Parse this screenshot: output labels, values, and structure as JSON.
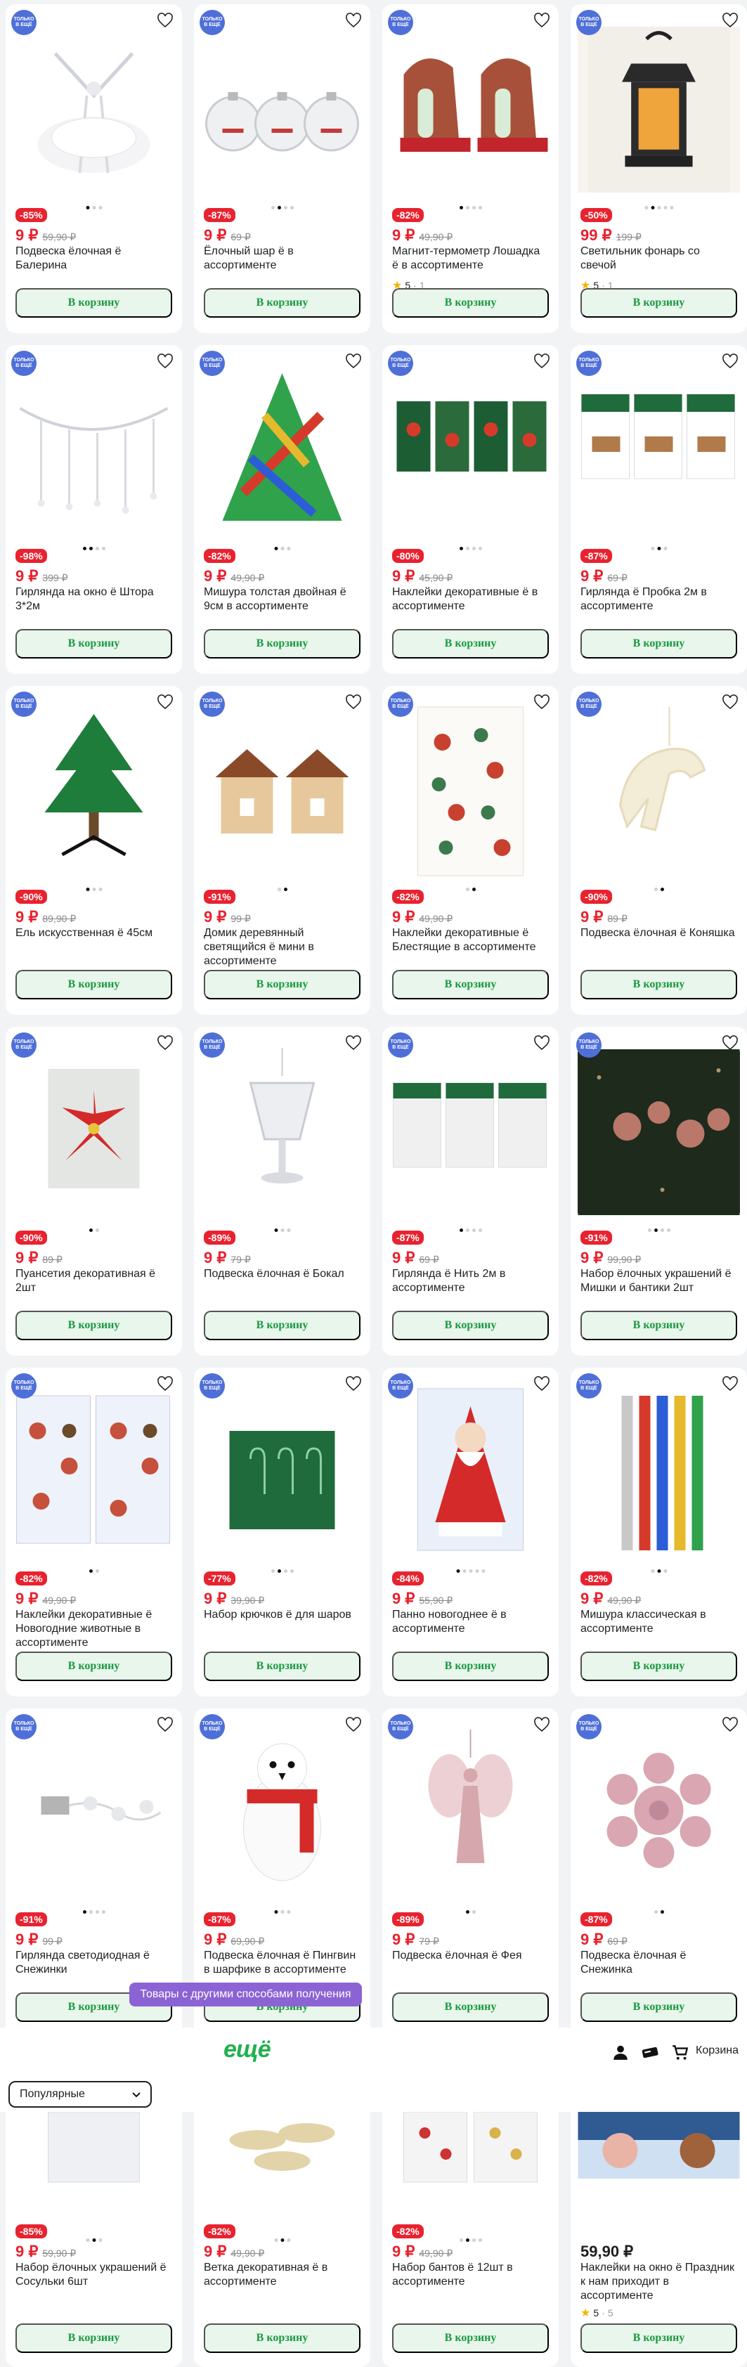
{
  "badge_text": "ТОЛЬКО В ЕЩЁ",
  "add_to_cart_label": "В корзину",
  "products": [
    {
      "discount": "-85%",
      "price": "9 ₽",
      "old_price": "59,90 ₽",
      "title": "Подвеска ёлочная ё Балерина",
      "rating": "",
      "rating_count": "",
      "icon": "ballerina-icon"
    },
    {
      "discount": "-87%",
      "price": "9 ₽",
      "old_price": "69 ₽",
      "title": "Ёлочный шар ё в ассортименте",
      "rating": "",
      "rating_count": "",
      "icon": "ornament-balls-icon"
    },
    {
      "discount": "-82%",
      "price": "9 ₽",
      "old_price": "49,90 ₽",
      "title": "Магнит-термометр Лошадка ё в ассортименте",
      "rating": "5",
      "rating_count": "1",
      "icon": "horse-magnet-icon"
    },
    {
      "discount": "-50%",
      "price": "99 ₽",
      "old_price": "199 ₽",
      "title": "Светильник фонарь со свечой",
      "rating": "5",
      "rating_count": "1",
      "icon": "lantern-icon"
    },
    {
      "discount": "-98%",
      "price": "9 ₽",
      "old_price": "399 ₽",
      "title": "Гирлянда на окно ё Штора 3*2м",
      "rating": "",
      "rating_count": "",
      "icon": "garland-curtain-icon"
    },
    {
      "discount": "-82%",
      "price": "9 ₽",
      "old_price": "49,90 ₽",
      "title": "Мишура толстая двойная ё 9см в ассортименте",
      "rating": "",
      "rating_count": "",
      "icon": "tinsel-icon"
    },
    {
      "discount": "-80%",
      "price": "9 ₽",
      "old_price": "45,90 ₽",
      "title": "Наклейки декоративные ё в ассортименте",
      "rating": "",
      "rating_count": "",
      "icon": "stickers-icon"
    },
    {
      "discount": "-87%",
      "price": "9 ₽",
      "old_price": "69 ₽",
      "title": "Гирлянда ё Пробка 2м в ассортименте",
      "rating": "",
      "rating_count": "",
      "icon": "cork-garland-icon"
    },
    {
      "discount": "-90%",
      "price": "9 ₽",
      "old_price": "89,90 ₽",
      "title": "Ель искусственная ё 45см",
      "rating": "",
      "rating_count": "",
      "icon": "christmas-tree-icon"
    },
    {
      "discount": "-91%",
      "price": "9 ₽",
      "old_price": "99 ₽",
      "title": "Домик деревянный светящийся ё мини в ассортименте",
      "rating": "",
      "rating_count": "",
      "icon": "wooden-house-icon"
    },
    {
      "discount": "-82%",
      "price": "9 ₽",
      "old_price": "49,90 ₽",
      "title": "Наклейки декоративные ё Блестящие в ассортименте",
      "rating": "",
      "rating_count": "",
      "icon": "glitter-stickers-icon"
    },
    {
      "discount": "-90%",
      "price": "9 ₽",
      "old_price": "89 ₽",
      "title": "Подвеска ёлочная ё Коняшка",
      "rating": "",
      "rating_count": "",
      "icon": "horse-ornament-icon"
    },
    {
      "discount": "-90%",
      "price": "9 ₽",
      "old_price": "89 ₽",
      "title": "Пуансетия декоративная ё 2шт",
      "rating": "",
      "rating_count": "",
      "icon": "poinsettia-icon"
    },
    {
      "discount": "-89%",
      "price": "9 ₽",
      "old_price": "79 ₽",
      "title": "Подвеска ёлочная ё Бокал",
      "rating": "",
      "rating_count": "",
      "icon": "glass-ornament-icon"
    },
    {
      "discount": "-87%",
      "price": "9 ₽",
      "old_price": "69 ₽",
      "title": "Гирлянда ё Нить 2м в ассортименте",
      "rating": "",
      "rating_count": "",
      "icon": "string-garland-icon"
    },
    {
      "discount": "-91%",
      "price": "9 ₽",
      "old_price": "99,90 ₽",
      "title": "Набор ёлочных украшений ё Мишки и бантики 2шт",
      "rating": "",
      "rating_count": "",
      "icon": "bears-bows-icon"
    },
    {
      "discount": "-82%",
      "price": "9 ₽",
      "old_price": "49,90 ₽",
      "title": "Наклейки декоративные ё Новогодние животные в ассортименте",
      "rating": "",
      "rating_count": "",
      "icon": "animal-stickers-icon"
    },
    {
      "discount": "-77%",
      "price": "9 ₽",
      "old_price": "39,90 ₽",
      "title": "Набор крючков ё для шаров",
      "rating": "",
      "rating_count": "",
      "icon": "hooks-icon"
    },
    {
      "discount": "-84%",
      "price": "9 ₽",
      "old_price": "55,90 ₽",
      "title": "Панно новогоднее ё в ассортименте",
      "rating": "",
      "rating_count": "",
      "icon": "santa-panel-icon"
    },
    {
      "discount": "-82%",
      "price": "9 ₽",
      "old_price": "49,90 ₽",
      "title": "Мишура классическая в ассортименте",
      "rating": "",
      "rating_count": "",
      "icon": "classic-tinsel-icon"
    },
    {
      "discount": "-91%",
      "price": "9 ₽",
      "old_price": "99 ₽",
      "title": "Гирлянда светодиодная ё Снежинки",
      "rating": "",
      "rating_count": "",
      "icon": "snowflake-garland-icon"
    },
    {
      "discount": "-87%",
      "price": "9 ₽",
      "old_price": "69,90 ₽",
      "title": "Подвеска ёлочная ё Пингвин в шарфике в ассортименте",
      "rating": "",
      "rating_count": "",
      "icon": "penguin-icon"
    },
    {
      "discount": "-89%",
      "price": "9 ₽",
      "old_price": "79 ₽",
      "title": "Подвеска ёлочная ё Фея",
      "rating": "",
      "rating_count": "",
      "icon": "fairy-icon"
    },
    {
      "discount": "-87%",
      "price": "9 ₽",
      "old_price": "69 ₽",
      "title": "Подвеска ёлочная ё Снежинка",
      "rating": "",
      "rating_count": "",
      "icon": "snowflake-ornament-icon"
    }
  ],
  "toast": "Товары с другими способами получения",
  "header": {
    "logo": "ещё",
    "cart_label": "Корзина"
  },
  "sort": {
    "selected": "Популярные"
  },
  "products_bottom": [
    {
      "discount": "-85%",
      "price": "9 ₽",
      "old_price": "59,90 ₽",
      "title": "Набор ёлочных украшений ё Сосульки 6шт",
      "rating": "",
      "rating_count": ""
    },
    {
      "discount": "-82%",
      "price": "9 ₽",
      "old_price": "49,90 ₽",
      "title": "Ветка декоративная ё в ассортименте",
      "rating": "",
      "rating_count": ""
    },
    {
      "discount": "-82%",
      "price": "9 ₽",
      "old_price": "49,90 ₽",
      "title": "Набор бантов ё 12шт в ассортименте",
      "rating": "",
      "rating_count": ""
    },
    {
      "discount": "",
      "price": "59,90 ₽",
      "old_price": "",
      "title": "Наклейки на окно ё Праздник к нам приходит в ассортименте",
      "rating": "5",
      "rating_count": "5"
    }
  ],
  "colors": {
    "accent_red": "#e8222f",
    "button_green": "#1a9a3f",
    "button_bg": "#e8f6ec",
    "badge_blue": "#4f6fd8",
    "toast_purple": "#8b63d4",
    "logo_green": "#1fb14d"
  }
}
